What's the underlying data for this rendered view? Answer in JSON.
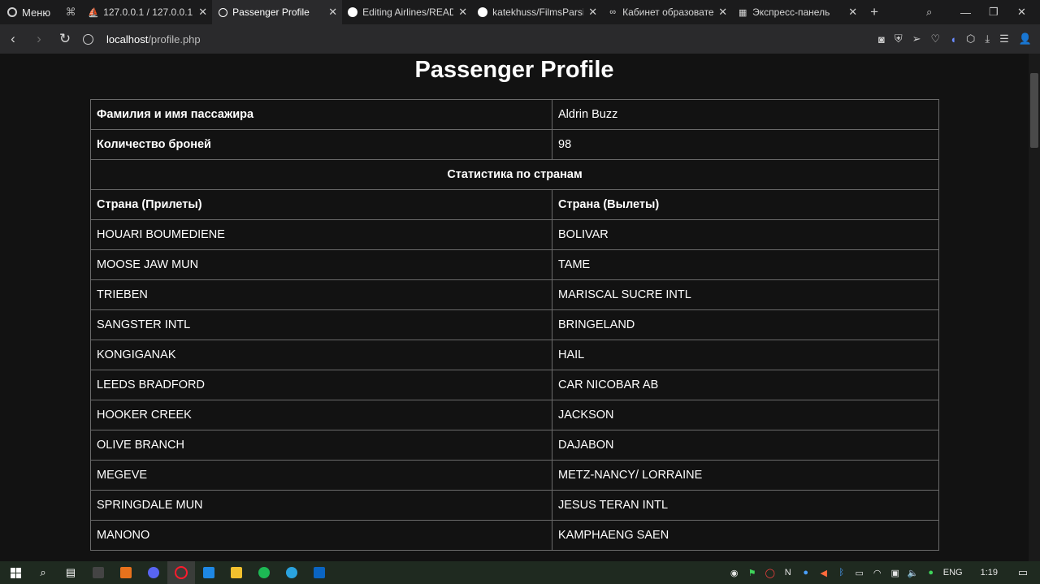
{
  "browser": {
    "menu_label": "Меню",
    "tabs": [
      {
        "title": "127.0.0.1 / 127.0.0.1 /",
        "favicon": "phpmyadmin-icon",
        "active": false
      },
      {
        "title": "Passenger Profile",
        "favicon": "globe-icon",
        "active": true
      },
      {
        "title": "Editing Airlines/READM",
        "favicon": "github-icon",
        "active": false
      },
      {
        "title": "katekhuss/FilmsParsing",
        "favicon": "github-icon",
        "active": false
      },
      {
        "title": "Кабинет образователь",
        "favicon": "infinity-icon",
        "active": false
      },
      {
        "title": "Экспресс-панель",
        "favicon": "grid-icon",
        "active": false
      }
    ],
    "url_host": "localhost",
    "url_path": "/profile.php"
  },
  "page": {
    "title": "Passenger Profile",
    "name_label": "Фамилия и имя пассажира",
    "name_value": "Aldrin Buzz",
    "bookings_label": "Количество броней",
    "bookings_value": "98",
    "stats_header": "Статистика по странам",
    "arrivals_header": "Страна (Прилеты)",
    "departures_header": "Страна (Вылеты)",
    "rows": [
      {
        "arrival": "HOUARI BOUMEDIENE",
        "departure": "BOLIVAR"
      },
      {
        "arrival": "MOOSE JAW MUN",
        "departure": "TAME"
      },
      {
        "arrival": "TRIEBEN",
        "departure": "MARISCAL SUCRE INTL"
      },
      {
        "arrival": "SANGSTER INTL",
        "departure": "BRINGELAND"
      },
      {
        "arrival": "KONGIGANAK",
        "departure": "HAIL"
      },
      {
        "arrival": "LEEDS BRADFORD",
        "departure": "CAR NICOBAR AB"
      },
      {
        "arrival": "HOOKER CREEK",
        "departure": "JACKSON"
      },
      {
        "arrival": "OLIVE BRANCH",
        "departure": "DAJABON"
      },
      {
        "arrival": "MEGEVE",
        "departure": "METZ-NANCY/ LORRAINE"
      },
      {
        "arrival": "SPRINGDALE MUN",
        "departure": "JESUS TERAN INTL"
      },
      {
        "arrival": "MANONO",
        "departure": "KAMPHAENG SAEN"
      }
    ]
  },
  "taskbar": {
    "language": "ENG",
    "time": "1:19"
  }
}
